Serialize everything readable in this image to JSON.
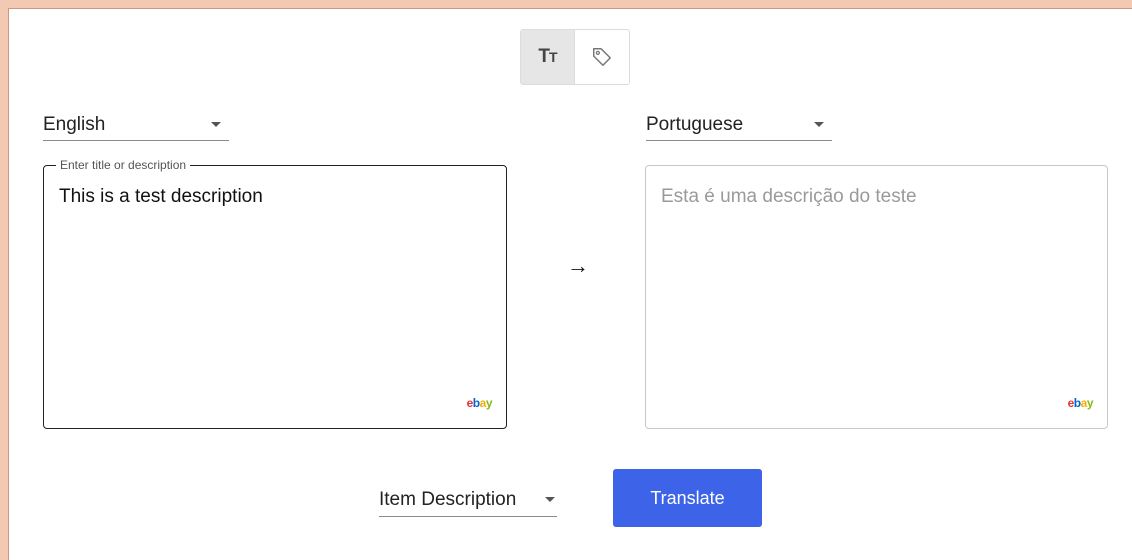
{
  "mode_toggle": {
    "text_mode_icon": "text-size-icon",
    "text_mode_glyph_large": "T",
    "text_mode_glyph_small": "T",
    "tag_mode_icon": "tag-icon",
    "active": "text"
  },
  "source_language": {
    "value": "English"
  },
  "target_language": {
    "value": "Portuguese"
  },
  "source_box": {
    "legend": "Enter title or description",
    "text": "This is a test description",
    "logo": {
      "e": "e",
      "b": "b",
      "a": "a",
      "y": "y"
    }
  },
  "target_box": {
    "text": "Esta é uma descrição do teste",
    "logo": {
      "e": "e",
      "b": "b",
      "a": "a",
      "y": "y"
    }
  },
  "arrow": "→",
  "content_type": {
    "value": "Item Description"
  },
  "translate_button": {
    "label": "Translate",
    "color": "#3c63e8"
  }
}
